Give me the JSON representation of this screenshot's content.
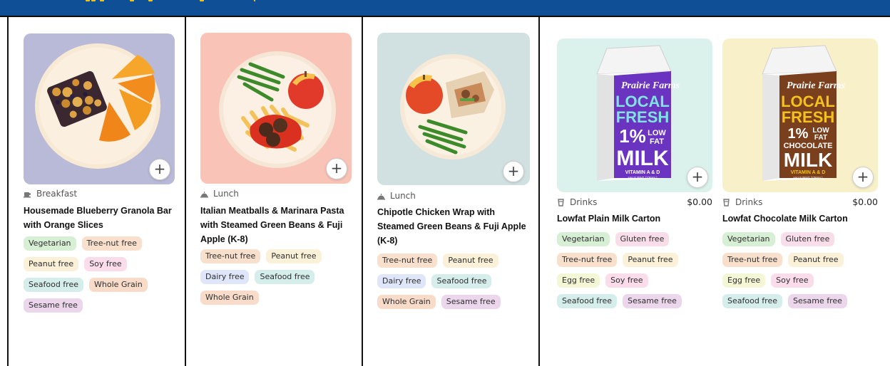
{
  "header": {
    "accent": "#0e4f96"
  },
  "cards": [
    {
      "category": "Breakfast",
      "category_icon": "breakfast-icon",
      "title": "Housemade Blueberry Granola Bar with Orange Slices",
      "tags": [
        "Vegetarian",
        "Tree-nut free",
        "Peanut free",
        "Soy free",
        "Seafood free",
        "Whole Grain",
        "Sesame free"
      ],
      "image_bg": "#b9b9d8"
    },
    {
      "category": "Lunch",
      "category_icon": "lunch-icon",
      "title": "Italian Meatballs & Marinara Pasta with Steamed Green Beans & Fuji Apple (K-8)",
      "tags": [
        "Tree-nut free",
        "Peanut free",
        "Dairy free",
        "Seafood free",
        "Whole Grain"
      ],
      "image_bg": "#f9c3b7"
    },
    {
      "category": "Lunch",
      "category_icon": "lunch-icon",
      "title": "Chipotle Chicken Wrap with Steamed Green Beans & Fuji Apple (K-8)",
      "tags": [
        "Tree-nut free",
        "Peanut free",
        "Dairy free",
        "Seafood free",
        "Whole Grain",
        "Sesame free"
      ],
      "image_bg": "#d1e0e0"
    },
    {
      "category": "Drinks",
      "category_icon": "drink-icon",
      "price": "$0.00",
      "title": "Lowfat Plain Milk Carton",
      "tags": [
        "Vegetarian",
        "Gluten free",
        "Tree-nut free",
        "Peanut free",
        "Egg free",
        "Soy free",
        "Seafood free",
        "Sesame free"
      ],
      "image_bg": "#daf1ec",
      "carton": {
        "brand": "Prairie Farms",
        "line1": "LOCAL",
        "line2": "FRESH",
        "pct": "1%",
        "low": "LOW",
        "fat": "FAT",
        "kind": "",
        "milk": "MILK",
        "vit": "VITAMIN A & D",
        "pint": "HALF PINT (236mL)",
        "color": "#6a33c0"
      }
    },
    {
      "category": "Drinks",
      "category_icon": "drink-icon",
      "price": "$0.00",
      "title": "Lowfat Chocolate Milk Carton",
      "tags": [
        "Vegetarian",
        "Gluten free",
        "Tree-nut free",
        "Peanut free",
        "Egg free",
        "Soy free",
        "Seafood free",
        "Sesame free"
      ],
      "image_bg": "#f8f0c9",
      "carton": {
        "brand": "Prairie Farms",
        "line1": "LOCAL",
        "line2": "FRESH",
        "pct": "1%",
        "low": "LOW",
        "fat": "FAT",
        "kind": "CHOCOLATE",
        "milk": "MILK",
        "vit": "VITAMIN A & D",
        "pint": "HALF PINT (236mL)",
        "color": "#7a3f1d"
      }
    }
  ]
}
